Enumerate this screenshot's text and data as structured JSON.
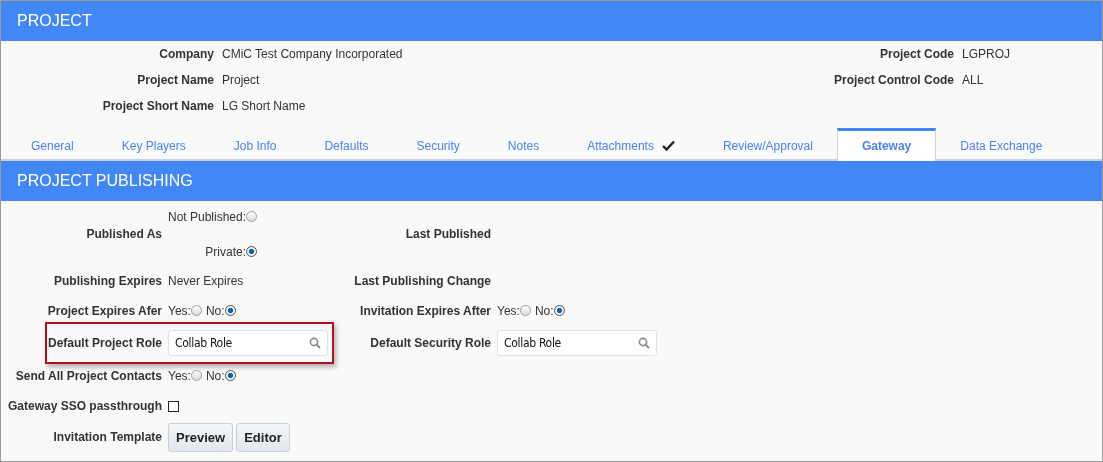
{
  "header": {
    "title": "PROJECT"
  },
  "project_info": {
    "left": [
      {
        "label": "Company",
        "value": "CMiC Test Company Incorporated"
      },
      {
        "label": "Project Name",
        "value": "Project"
      },
      {
        "label": "Project Short Name",
        "value": "LG Short Name"
      }
    ],
    "right": [
      {
        "label": "Project Code",
        "value": "LGPROJ"
      },
      {
        "label": "Project Control Code",
        "value": "ALL"
      }
    ]
  },
  "tabs": [
    {
      "label": "General",
      "selected": false,
      "checked": false
    },
    {
      "label": "Key Players",
      "selected": false,
      "checked": false
    },
    {
      "label": "Job Info",
      "selected": false,
      "checked": false
    },
    {
      "label": "Defaults",
      "selected": false,
      "checked": false
    },
    {
      "label": "Security",
      "selected": false,
      "checked": false
    },
    {
      "label": "Notes",
      "selected": false,
      "checked": false
    },
    {
      "label": "Attachments",
      "selected": false,
      "checked": true
    },
    {
      "label": "Review/Approval",
      "selected": false,
      "checked": false
    },
    {
      "label": "Gateway",
      "selected": true,
      "checked": false
    },
    {
      "label": "Data Exchange",
      "selected": false,
      "checked": false
    }
  ],
  "section": {
    "title": "PROJECT PUBLISHING"
  },
  "form": {
    "rows": [
      {
        "left": {
          "label": "Published As",
          "kind": "radio_stack",
          "options": [
            {
              "label": "Not Published:",
              "selected": false
            },
            {
              "label": "Private:",
              "selected": true
            }
          ]
        },
        "right": {
          "label": "Last Published"
        }
      },
      {
        "left": {
          "label": "Publishing Expires",
          "kind": "text",
          "value": "Never Expires"
        },
        "right": {
          "label": "Last Publishing Change"
        }
      },
      {
        "left": {
          "label": "Project Expires Afer",
          "kind": "radio_pair",
          "options": [
            {
              "label": "Yes:",
              "selected": false
            },
            {
              "label": "No:",
              "selected": true
            }
          ]
        },
        "right": {
          "label": "Invitation Expires After",
          "kind": "radio_pair",
          "options": [
            {
              "label": "Yes:",
              "selected": false
            },
            {
              "label": "No:",
              "selected": true
            }
          ]
        }
      },
      {
        "left": {
          "label": "Default Project Role",
          "kind": "lookup",
          "value": "Collab Role",
          "highlighted": true
        },
        "right": {
          "label": "Default Security Role",
          "kind": "lookup",
          "value": "Collab Role",
          "highlighted": false
        }
      },
      {
        "left": {
          "label": "Send All Project Contacts",
          "kind": "radio_pair",
          "options": [
            {
              "label": "Yes:",
              "selected": false
            },
            {
              "label": "No:",
              "selected": true
            }
          ]
        }
      },
      {
        "left": {
          "label": "Gateway SSO passthrough",
          "kind": "checkbox",
          "checked": false
        }
      },
      {
        "left": {
          "label": "Invitation Template",
          "kind": "buttons",
          "buttons": [
            "Preview",
            "Editor"
          ]
        }
      }
    ]
  }
}
